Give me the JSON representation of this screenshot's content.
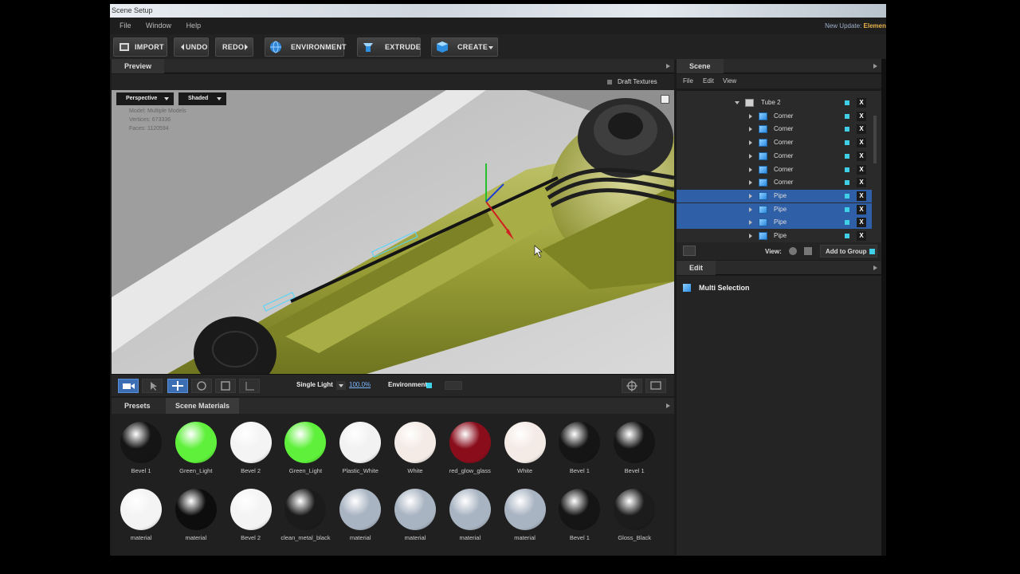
{
  "window": {
    "title": "Scene Setup"
  },
  "menu": {
    "items": [
      "File",
      "Window",
      "Help"
    ],
    "update_prefix": "New Update: ",
    "update_name": "Elemen"
  },
  "toolbar": {
    "import": "IMPORT",
    "undo": "UNDO",
    "redo": "REDO",
    "environment": "ENVIRONMENT",
    "extrude": "EXTRUDE",
    "create": "CREATE"
  },
  "preview": {
    "title": "Preview",
    "draft_textures": "Draft Textures",
    "camera_mode": "Perspective",
    "shading_mode": "Shaded",
    "stats": {
      "model": "Model: Multiple Models",
      "vertices": "Vertices: 673336",
      "faces": "Faces: 1120594"
    }
  },
  "viewport_toolbar": {
    "lighting": "Single Light",
    "zoom": "100.0%",
    "environment": "Environment"
  },
  "materials": {
    "tabs": [
      "Presets",
      "Scene Materials"
    ],
    "active_tab": "Scene Materials",
    "items": [
      {
        "name": "Bevel 1",
        "color": "#151515"
      },
      {
        "name": "Green_Light",
        "color": "#5ef03a"
      },
      {
        "name": "Bevel 2",
        "color": "#f4f4f4"
      },
      {
        "name": "Green_Light",
        "color": "#5ef03a"
      },
      {
        "name": "Plastic_White",
        "color": "#f2f2f2"
      },
      {
        "name": "White",
        "color": "#f4ebe6"
      },
      {
        "name": "red_glow_glass",
        "color": "#8a0d1c"
      },
      {
        "name": "White",
        "color": "#f4ebe6"
      },
      {
        "name": "Bevel 1",
        "color": "#151515"
      },
      {
        "name": "Bevel 1",
        "color": "#151515"
      },
      {
        "name": "material",
        "color": "#f4f4f4"
      },
      {
        "name": "material",
        "color": "#0d0d0d"
      },
      {
        "name": "Bevel 2",
        "color": "#f4f4f4"
      },
      {
        "name": "clean_metal_black",
        "color": "#1b1b1b"
      },
      {
        "name": "material",
        "color": "#a9b4c2"
      },
      {
        "name": "material",
        "color": "#a9b4c2"
      },
      {
        "name": "material",
        "color": "#a9b4c2"
      },
      {
        "name": "material",
        "color": "#a9b4c2"
      },
      {
        "name": "Bevel 1",
        "color": "#151515"
      },
      {
        "name": "Gloss_Black",
        "color": "#1c1c1c"
      }
    ]
  },
  "scene": {
    "title": "Scene",
    "menu": [
      "File",
      "Edit",
      "View"
    ],
    "tree": [
      {
        "name": "Tube 2",
        "type": "folder",
        "selected": false
      },
      {
        "name": "Corner",
        "type": "object",
        "selected": false
      },
      {
        "name": "Corner",
        "type": "object",
        "selected": false
      },
      {
        "name": "Corner",
        "type": "object",
        "selected": false
      },
      {
        "name": "Corner",
        "type": "object",
        "selected": false
      },
      {
        "name": "Corner",
        "type": "object",
        "selected": false
      },
      {
        "name": "Corner",
        "type": "object",
        "selected": false
      },
      {
        "name": "Pipe",
        "type": "object",
        "selected": true
      },
      {
        "name": "Pipe",
        "type": "object",
        "selected": true
      },
      {
        "name": "Pipe",
        "type": "object",
        "selected": true
      },
      {
        "name": "Pipe",
        "type": "object",
        "selected": false
      }
    ],
    "view_label": "View:",
    "add_to_group": "Add to Group",
    "delete_mark": "X"
  },
  "edit": {
    "title": "Edit",
    "selection": "Multi Selection"
  }
}
